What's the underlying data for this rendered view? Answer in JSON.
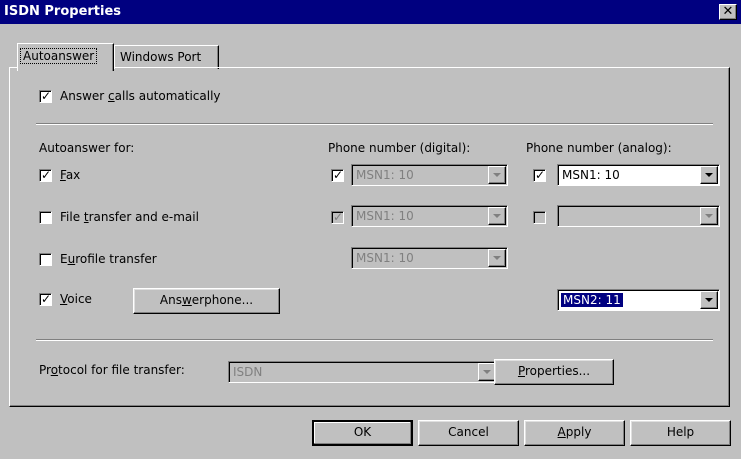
{
  "window": {
    "title": "ISDN Properties",
    "close_glyph": "✕"
  },
  "tabs": [
    {
      "label": "Autoanswer"
    },
    {
      "label": "Windows Port"
    }
  ],
  "answer_calls": {
    "pre": "Answer ",
    "accel": "c",
    "post": "alls automatically",
    "checked": true
  },
  "headers": {
    "autoanswer_for": "Autoanswer for:",
    "digital": "Phone number (digital):",
    "analog": "Phone number (analog):"
  },
  "rows": {
    "fax": {
      "pre": "",
      "accel": "F",
      "post": "ax",
      "checked": true,
      "digital_checked": true,
      "digital_value": "MSN1: 10",
      "analog_checked": true,
      "analog_value": "MSN1: 10"
    },
    "file_transfer": {
      "pre": "File ",
      "accel": "t",
      "post": "ransfer and e-mail",
      "checked": false,
      "digital_checked": true,
      "digital_value": "MSN1: 10",
      "analog_checked": false,
      "analog_value": ""
    },
    "eurofile": {
      "pre": "E",
      "accel": "u",
      "post": "rofile transfer",
      "checked": false,
      "digital_value": "MSN1: 10"
    },
    "voice": {
      "pre": "",
      "accel": "V",
      "post": "oice",
      "checked": true,
      "analog_value": "MSN2: 11"
    }
  },
  "answerphone_button": {
    "pre": "Ans",
    "accel": "w",
    "post": "erphone..."
  },
  "protocol": {
    "pre": "Pr",
    "accel": "o",
    "post": "tocol for file transfer:",
    "value": "ISDN"
  },
  "properties_button": {
    "pre": "",
    "accel": "P",
    "post": "roperties..."
  },
  "footer": {
    "ok": "OK",
    "cancel": "Cancel",
    "apply_pre": "",
    "apply_accel": "A",
    "apply_post": "pply",
    "help": "Help"
  },
  "glyphs": {
    "check": "✓"
  }
}
